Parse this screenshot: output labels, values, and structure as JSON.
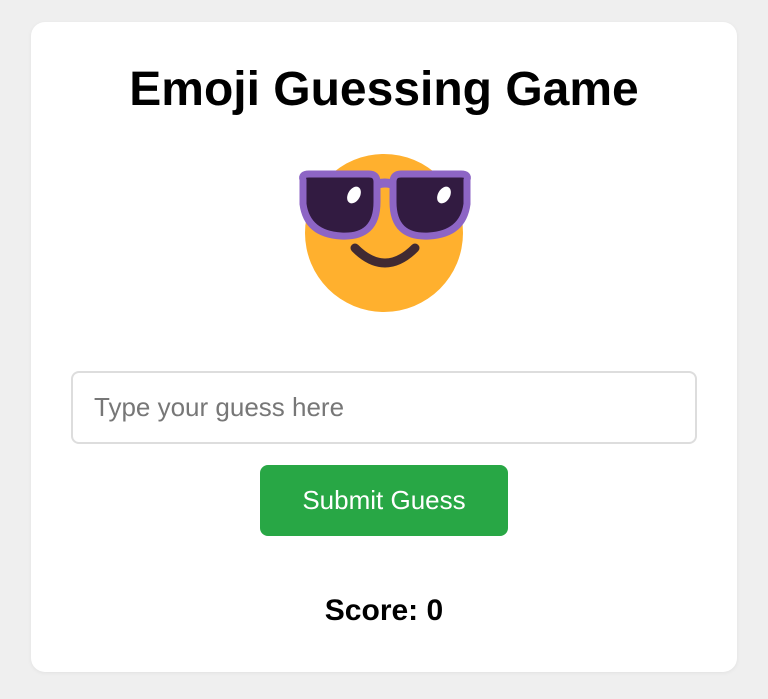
{
  "game": {
    "title": "Emoji Guessing Game",
    "emoji": {
      "icon": "smiling-face-with-sunglasses-icon",
      "colors": {
        "face": "#ffb02e",
        "lens": "#321b41",
        "frame": "#8d65c5",
        "smile": "#402a32"
      }
    },
    "guess_input": {
      "value": "",
      "placeholder": "Type your guess here"
    },
    "submit_label": "Submit Guess",
    "score_text": "Score: 0"
  },
  "colors": {
    "page_background": "#efefef",
    "card_background": "#ffffff",
    "button": "#28a745",
    "button_text": "#ffffff"
  }
}
